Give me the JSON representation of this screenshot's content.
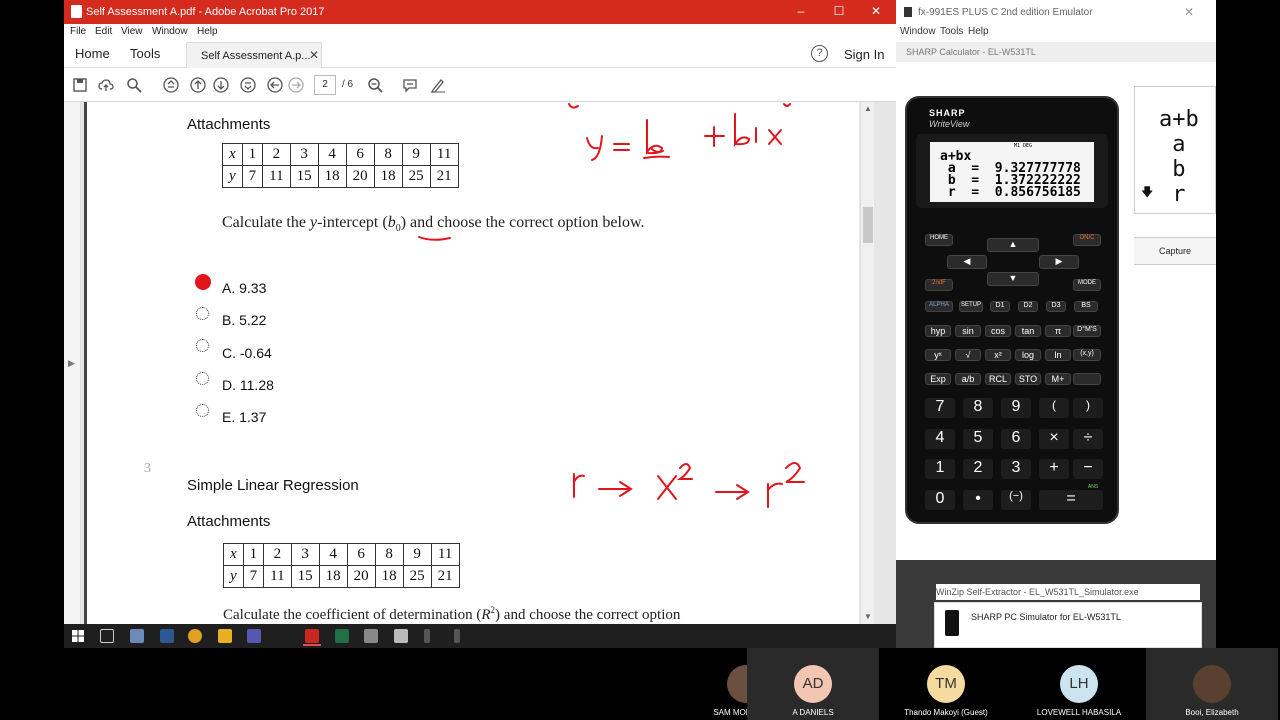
{
  "acrobat": {
    "title": "Self Assessment A.pdf - Adobe Acrobat Pro 2017",
    "window_controls": [
      "–",
      "☐",
      "✕"
    ],
    "menu": [
      "File",
      "Edit",
      "View",
      "Window",
      "Help"
    ],
    "nav": {
      "home": "Home",
      "tools": "Tools",
      "doc_tab": "Self Assessment A.p...",
      "close": "✕",
      "help": "?",
      "sign_in": "Sign In"
    },
    "toolbar": {
      "page_current": "2",
      "page_total": "/ 6"
    },
    "document": {
      "q2": {
        "attachments": "Attachments",
        "table": {
          "x_label": "x",
          "y_label": "y",
          "x": [
            "1",
            "2",
            "3",
            "4",
            "6",
            "8",
            "9",
            "11"
          ],
          "y": [
            "7",
            "11",
            "15",
            "18",
            "20",
            "18",
            "25",
            "21"
          ]
        },
        "prompt_prefix": "Calculate the ",
        "prompt_var": "y",
        "prompt_middle": "-intercept (",
        "prompt_b": "b",
        "prompt_sub": "0",
        "prompt_suffix": ") and choose the correct option below.",
        "options": [
          "A. 9.33",
          "B. 5.22",
          "C. -0.64",
          "D. 11.28",
          "E. 1.37"
        ],
        "selected_index": 0
      },
      "q3": {
        "number": "3",
        "title": "Simple Linear Regression",
        "attachments": "Attachments",
        "table": {
          "x_label": "x",
          "y_label": "y",
          "x": [
            "1",
            "2",
            "3",
            "4",
            "6",
            "8",
            "9",
            "11"
          ],
          "y": [
            "7",
            "11",
            "15",
            "18",
            "20",
            "18",
            "25",
            "21"
          ]
        },
        "prompt_prefix": "Calculate the coefficient of determination (",
        "prompt_r": "R",
        "prompt_sup": "2",
        "prompt_suffix": ") and choose the correct option"
      }
    }
  },
  "emulator": {
    "title": "fx-991ES PLUS C 2nd edition Emulator",
    "menu": [
      "Window",
      "Tools",
      "Help"
    ],
    "sharp_title": "SHARP Calculator - EL-W531TL",
    "brand": "SHARP",
    "model_line": "WriteView",
    "lcd": {
      "indicators": "M1   DEG",
      "lines": [
        "a+bx",
        " a  =  9.327777778",
        " b  =  1.372222222",
        " r  =  0.856756185"
      ]
    },
    "capture_lcd": [
      "a+b",
      " a",
      " b",
      " r"
    ],
    "capture_label": "Capture",
    "keys": {
      "home": "HOME",
      "onc": "ON/C",
      "second": "2ndF",
      "mode": "MODE",
      "alpha": "ALPHA",
      "setup": "SETUP",
      "d1": "D1",
      "d2": "D2",
      "d3": "D3",
      "bs": "BS",
      "hyp": "hyp",
      "sin": "sin",
      "cos": "cos",
      "tan": "tan",
      "pi": "π",
      "dms": "D°M'S",
      "root": "√",
      "x2": "x²",
      "log": "log",
      "ln": "ln",
      "xy": "(x,y)",
      "exp": "Exp",
      "ab": "a/b",
      "rcl": "RCL",
      "sto": "STO",
      "mplus": "M+",
      "seven": "7",
      "eight": "8",
      "nine": "9",
      "lparen": "(",
      "rparen": ")",
      "four": "4",
      "five": "5",
      "six": "6",
      "times": "×",
      "divide": "÷",
      "one": "1",
      "two": "2",
      "three": "3",
      "plus": "+",
      "minus": "−",
      "zero": "0",
      "dot": "•",
      "neg": "(−)",
      "equals": "=",
      "ans": "ANS"
    }
  },
  "winzip": "WinZip Self-Extractor - EL_W531TL_Simulator.exe",
  "sharp_pc": "SHARP PC Simulator for EL-W531TL",
  "participants": [
    {
      "initials": "",
      "name": "SAM MOETI PIT...",
      "color": "#6a5040"
    },
    {
      "initials": "AD",
      "name": "A DANIELS",
      "color": "#f2c6b0"
    },
    {
      "initials": "TM",
      "name": "Thando Makoyi (Guest)",
      "color": "#f5dba0"
    },
    {
      "initials": "LH",
      "name": "LOVEWELL HABASILA",
      "color": "#cce3f0"
    },
    {
      "initials": "",
      "name": "Booi, Elizabeth",
      "color": "#5a4030"
    }
  ],
  "colors": {
    "acrobat_red": "#d52b1e",
    "radio_selected": "#e2141c",
    "ink_red": "#e2141c"
  }
}
